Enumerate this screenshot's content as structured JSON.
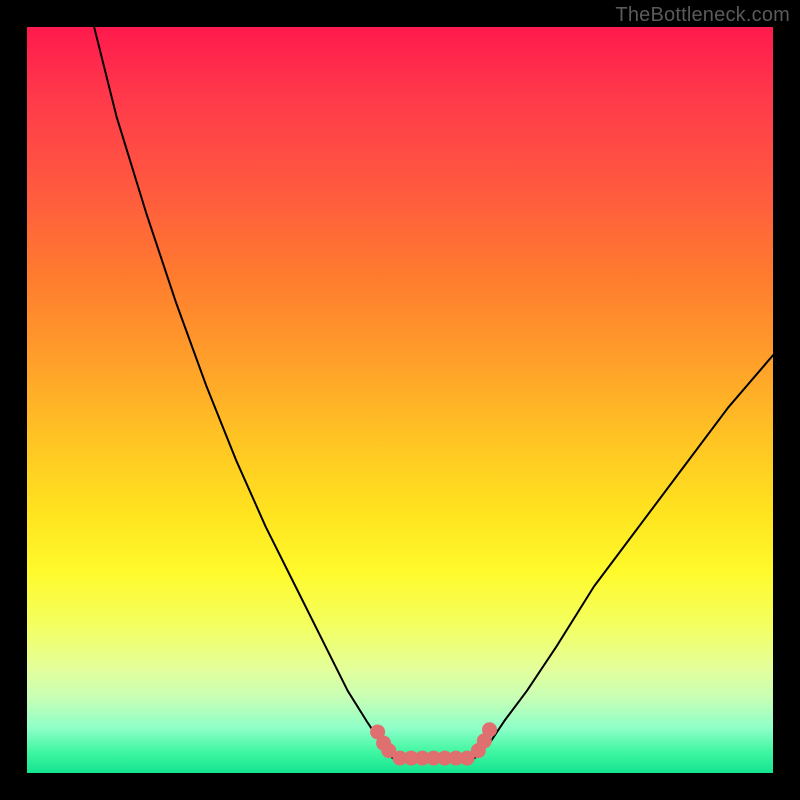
{
  "watermark": "TheBottleneck.com",
  "chart_data": {
    "type": "line",
    "title": "",
    "xlabel": "",
    "ylabel": "",
    "xlim": [
      0,
      100
    ],
    "ylim": [
      0,
      100
    ],
    "grid": false,
    "series": [
      {
        "name": "left-curve",
        "color": "#000000",
        "x": [
          9.0,
          12.0,
          16.0,
          20.0,
          24.0,
          28.0,
          32.0,
          36.0,
          40.0,
          43.0,
          45.5,
          47.5,
          49.0
        ],
        "y": [
          100.0,
          88.0,
          75.0,
          63.0,
          52.0,
          42.0,
          33.0,
          25.0,
          17.0,
          11.0,
          7.0,
          4.0,
          2.0
        ]
      },
      {
        "name": "right-curve",
        "color": "#000000",
        "x": [
          60.0,
          62.0,
          64.0,
          67.0,
          71.0,
          76.0,
          82.0,
          88.0,
          94.0,
          100.0
        ],
        "y": [
          2.0,
          4.0,
          7.0,
          11.0,
          17.0,
          25.0,
          33.0,
          41.0,
          49.0,
          56.0
        ]
      },
      {
        "name": "floor",
        "color": "#000000",
        "x": [
          49.0,
          60.0
        ],
        "y": [
          2.0,
          2.0
        ]
      }
    ],
    "markers": {
      "name": "valley-dots",
      "color": "#e07070",
      "points": [
        {
          "x": 47.0,
          "y": 5.5
        },
        {
          "x": 47.8,
          "y": 4.0
        },
        {
          "x": 48.5,
          "y": 3.0
        },
        {
          "x": 50.0,
          "y": 2.0
        },
        {
          "x": 51.5,
          "y": 2.0
        },
        {
          "x": 53.0,
          "y": 2.0
        },
        {
          "x": 54.5,
          "y": 2.0
        },
        {
          "x": 56.0,
          "y": 2.0
        },
        {
          "x": 57.5,
          "y": 2.0
        },
        {
          "x": 59.0,
          "y": 2.0
        },
        {
          "x": 60.5,
          "y": 3.0
        },
        {
          "x": 61.3,
          "y": 4.3
        },
        {
          "x": 62.0,
          "y": 5.8
        }
      ]
    }
  }
}
